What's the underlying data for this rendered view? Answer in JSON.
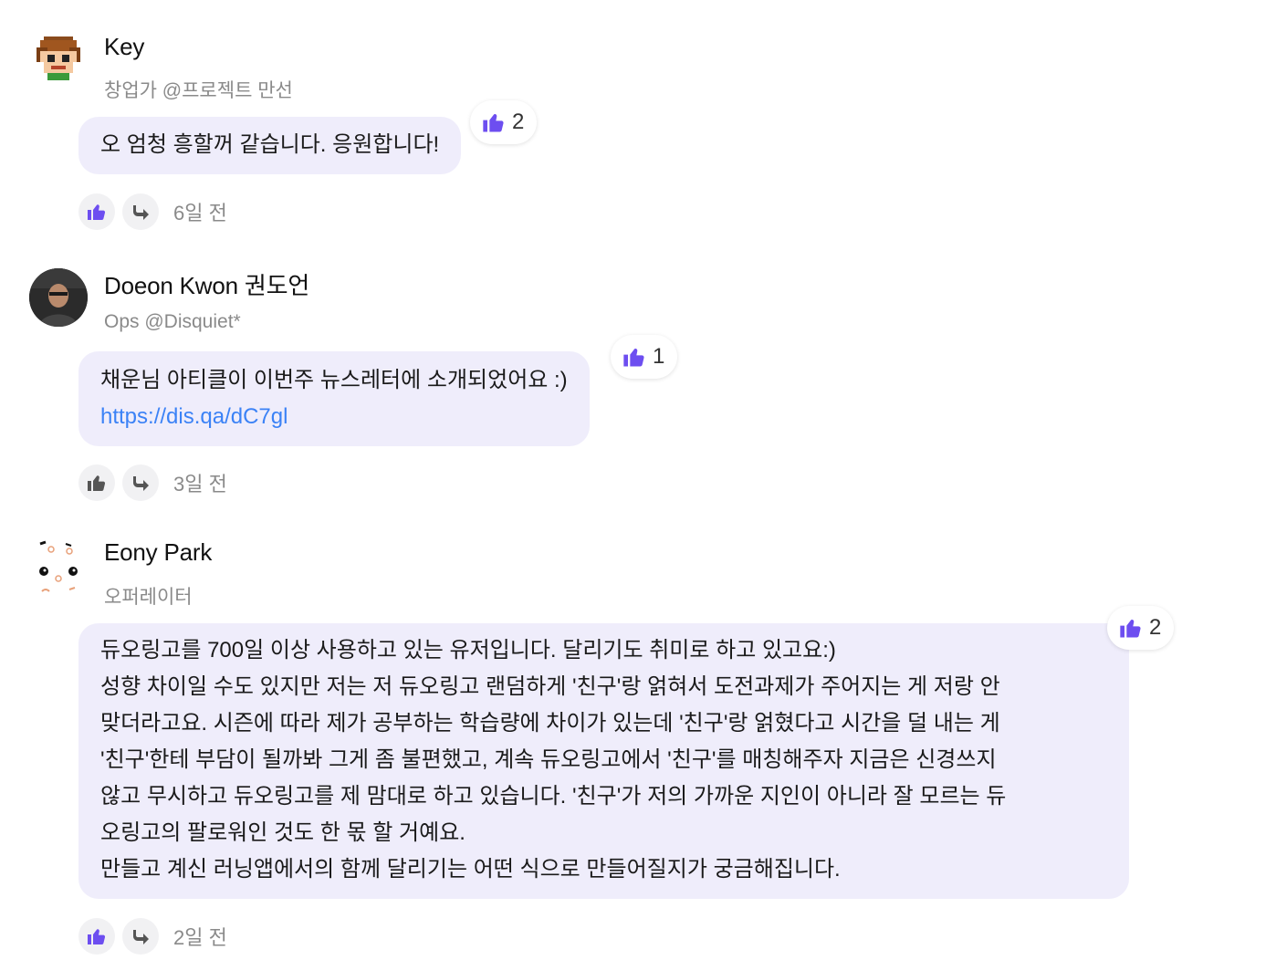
{
  "colors": {
    "accent": "#6d4ef0",
    "bubble_bg": "#efedfb",
    "link": "#3b82f6",
    "muted": "#8a8a8a",
    "icon_gray": "#555555"
  },
  "comments": [
    {
      "author": "Key",
      "subtitle": "창업가 @프로젝트 만선",
      "avatar_icon": "pixel-avatar-icon",
      "body_lines": [
        "오 엄청 흥할꺼 같습니다. 응원합니다!"
      ],
      "reaction_count": "2",
      "liked": true,
      "time": "6일 전"
    },
    {
      "author": "Doeon Kwon 권도언",
      "subtitle": "Ops @Disquiet*",
      "avatar_icon": "photo-avatar",
      "body_lines": [
        "채운님 아티클이 이번주 뉴스레터에 소개되었어요 :)"
      ],
      "link": "https://dis.qa/dC7gl",
      "reaction_count": "1",
      "liked": false,
      "time": "3일 전"
    },
    {
      "author": "Eony Park",
      "subtitle": "오퍼레이터",
      "avatar_icon": "doodle-avatar-icon",
      "body_lines": [
        "듀오링고를 700일 이상 사용하고 있는 유저입니다. 달리기도 취미로 하고 있고요:)",
        "성향 차이일 수도 있지만 저는 저 듀오링고 랜덤하게 '친구'랑 얽혀서 도전과제가 주어지는 게 저랑 안",
        "맞더라고요. 시즌에 따라 제가 공부하는 학습량에 차이가 있는데 '친구'랑 얽혔다고 시간을 덜 내는 게",
        "'친구'한테 부담이 될까봐 그게 좀 불편했고, 계속 듀오링고에서 '친구'를 매칭해주자 지금은 신경쓰지",
        "않고 무시하고 듀오링고를 제 맘대로 하고 있습니다. '친구'가 저의 가까운 지인이 아니라 잘 모르는 듀",
        "오링고의 팔로워인 것도 한 몫 할 거예요.",
        "만들고 계신 러닝앱에서의 함께 달리기는 어떤 식으로 만들어질지가 궁금해집니다."
      ],
      "reaction_count": "2",
      "liked": true,
      "time": "2일 전"
    }
  ]
}
